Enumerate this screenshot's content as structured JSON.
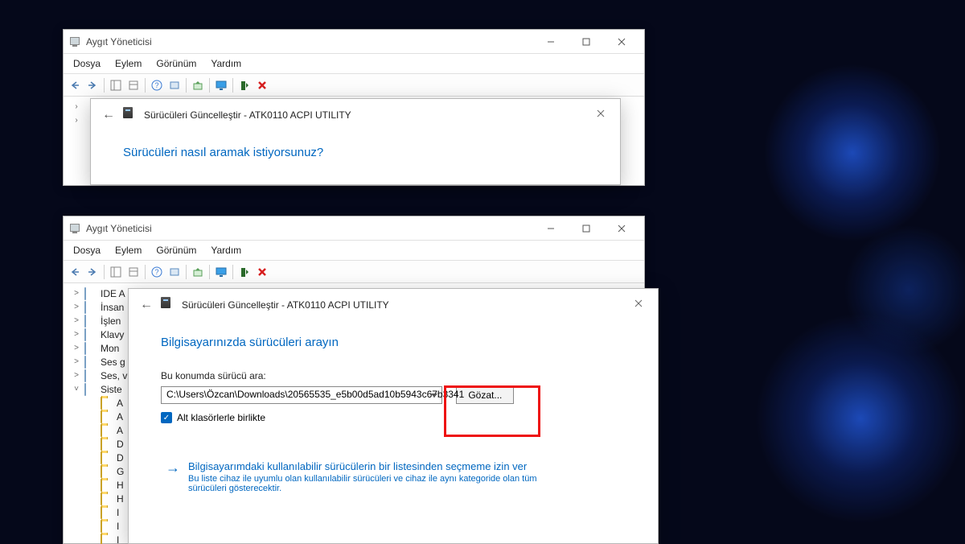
{
  "windows_top": {
    "title": "Aygıt Yöneticisi",
    "menu": [
      "Dosya",
      "Eylem",
      "Görünüm",
      "Yardım"
    ]
  },
  "windows_bottom": {
    "title": "Aygıt Yöneticisi",
    "menu": [
      "Dosya",
      "Eylem",
      "Görünüm",
      "Yardım"
    ],
    "tree": [
      {
        "exp": ">",
        "label": "IDE A"
      },
      {
        "exp": ">",
        "label": "İnsan"
      },
      {
        "exp": ">",
        "label": "İşlen"
      },
      {
        "exp": ">",
        "label": "Klavy"
      },
      {
        "exp": ">",
        "label": "Mon"
      },
      {
        "exp": ">",
        "label": "Ses g"
      },
      {
        "exp": ">",
        "label": "Ses, v"
      },
      {
        "exp": "˅",
        "label": "Siste"
      },
      {
        "exp": "",
        "label": "A",
        "child": true
      },
      {
        "exp": "",
        "label": "A",
        "child": true
      },
      {
        "exp": "",
        "label": "A",
        "child": true
      },
      {
        "exp": "",
        "label": "D",
        "child": true
      },
      {
        "exp": "",
        "label": "D",
        "child": true
      },
      {
        "exp": "",
        "label": "G",
        "child": true
      },
      {
        "exp": "",
        "label": "H",
        "child": true
      },
      {
        "exp": "",
        "label": "H",
        "child": true
      },
      {
        "exp": "",
        "label": "I",
        "child": true
      },
      {
        "exp": "",
        "label": "I",
        "child": true
      },
      {
        "exp": "",
        "label": "I",
        "child": true
      }
    ]
  },
  "wizard_top": {
    "title": "Sürücüleri Güncelleştir - ATK0110 ACPI UTILITY",
    "heading": "Sürücüleri nasıl aramak istiyorsunuz?"
  },
  "wizard_bottom": {
    "title": "Sürücüleri Güncelleştir - ATK0110 ACPI UTILITY",
    "heading": "Bilgisayarınızda sürücüleri arayın",
    "path_label": "Bu konumda sürücü ara:",
    "path_value": "C:\\Users\\Özcan\\Downloads\\20565535_e5b00d5ad10b5943c67b3341",
    "browse": "Gözat...",
    "subfolders": "Alt klasörlerle birlikte",
    "link_title": "Bilgisayarımdaki kullanılabilir sürücülerin bir listesinden seçmeme izin ver",
    "link_desc": "Bu liste cihaz ile uyumlu olan kullanılabilir sürücüleri ve cihaz ile aynı kategoride olan tüm sürücüleri gösterecektir."
  }
}
